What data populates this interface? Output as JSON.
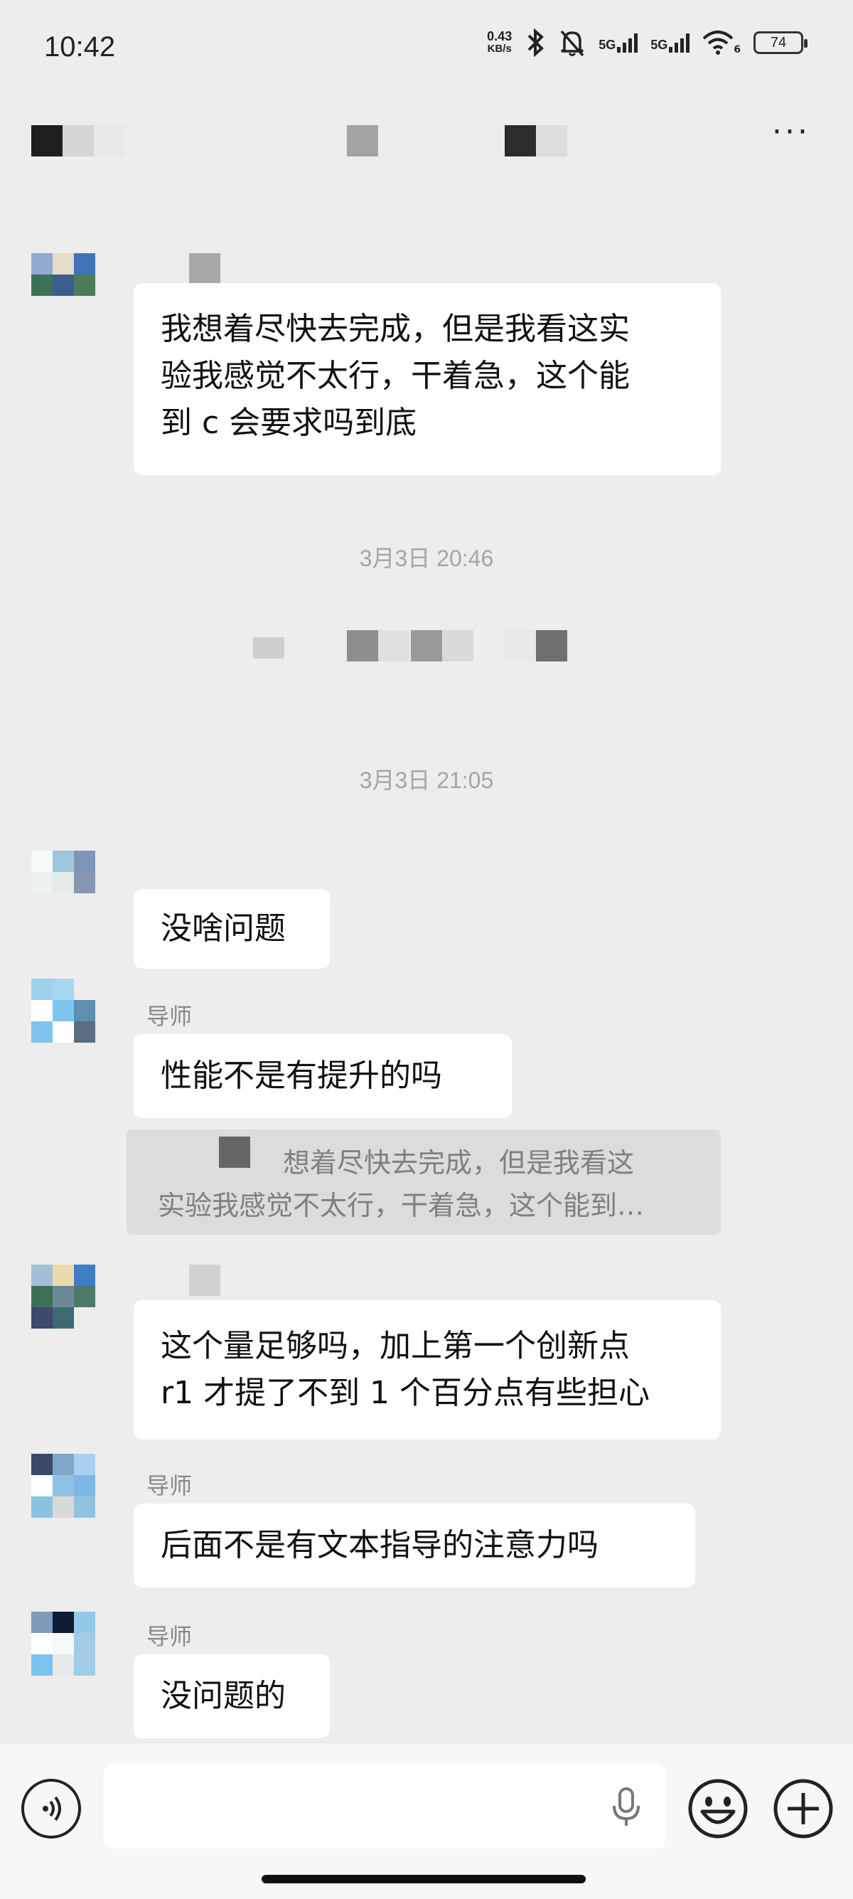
{
  "status_bar": {
    "time": "10:42",
    "net_speed_value": "0.43",
    "net_speed_unit": "KB/s",
    "signal1_label": "5G",
    "signal2_label": "5G",
    "wifi_sub": "6",
    "battery": "74",
    "icons": [
      "bluetooth-icon",
      "mute-bell-icon",
      "signal-icon",
      "wifi-icon",
      "battery-icon"
    ]
  },
  "chat_header": {
    "title": "",
    "more_icon": "more-icon"
  },
  "timestamps": [
    "3月3日 20:46",
    "3月3日 21:05"
  ],
  "messages": [
    {
      "sender": "",
      "lines": [
        "我想着尽快去完成，但是我看这实",
        "验我感觉不太行，干着急，这个能",
        "到 c 会要求吗到底"
      ]
    },
    {
      "sender": "",
      "lines": [
        "没啥问题"
      ]
    },
    {
      "sender": "导师",
      "lines": [
        "性能不是有提升的吗"
      ]
    },
    {
      "sender": "",
      "lines": [
        "这个量足够吗，加上第一个创新点",
        "r1 才提了不到 1 个百分点有些担心"
      ]
    },
    {
      "sender": "导师",
      "lines": [
        "后面不是有文本指导的注意力吗"
      ]
    },
    {
      "sender": "导师",
      "lines": [
        "没问题的"
      ]
    }
  ],
  "quote": {
    "line1": "想着尽快去完成，但是我看这",
    "line2": "实验我感觉不太行，干着急，这个能到…"
  },
  "input_bar": {
    "value": "",
    "icons": [
      "voice-icon",
      "mic-icon",
      "emoji-icon",
      "plus-icon"
    ]
  },
  "colors": {
    "background": "#ededed",
    "bubble": "#ffffff",
    "quote_bg": "#dcdcdc",
    "timestamp": "#a5a5a5"
  }
}
